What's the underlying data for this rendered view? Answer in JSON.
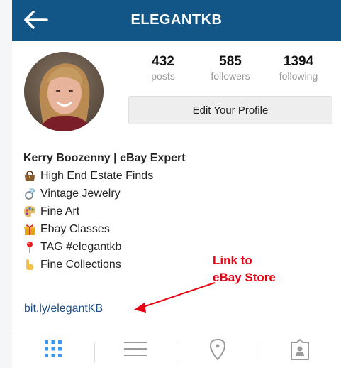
{
  "header": {
    "title": "ELEGANTKB"
  },
  "stats": [
    {
      "value": "432",
      "label": "posts"
    },
    {
      "value": "585",
      "label": "followers"
    },
    {
      "value": "1394",
      "label": "following"
    }
  ],
  "profile": {
    "edit_label": "Edit Your Profile"
  },
  "bio": {
    "name": "Kerry Boozenny | eBay Expert",
    "lines": [
      {
        "icon": "handbag-icon",
        "text": "High End Estate Finds"
      },
      {
        "icon": "ring-icon",
        "text": "Vintage Jewelry"
      },
      {
        "icon": "palette-icon",
        "text": "Fine Art"
      },
      {
        "icon": "gift-icon",
        "text": "Ebay Classes"
      },
      {
        "icon": "pin-icon",
        "text": "TAG #elegantkb"
      },
      {
        "icon": "pointing-hand-icon",
        "text": "Fine Collections"
      }
    ],
    "link": "bit.ly/elegantKB"
  },
  "annotation": {
    "line1": "Link to",
    "line2": "eBay Store",
    "color": "#e60012"
  },
  "tabs": [
    {
      "icon": "grid-icon",
      "active": true
    },
    {
      "icon": "list-icon",
      "active": false
    },
    {
      "icon": "location-icon",
      "active": false
    },
    {
      "icon": "tagged-icon",
      "active": false
    }
  ],
  "colors": {
    "header": "#125688",
    "link": "#1e4f88",
    "active_tab": "#3897f0"
  }
}
